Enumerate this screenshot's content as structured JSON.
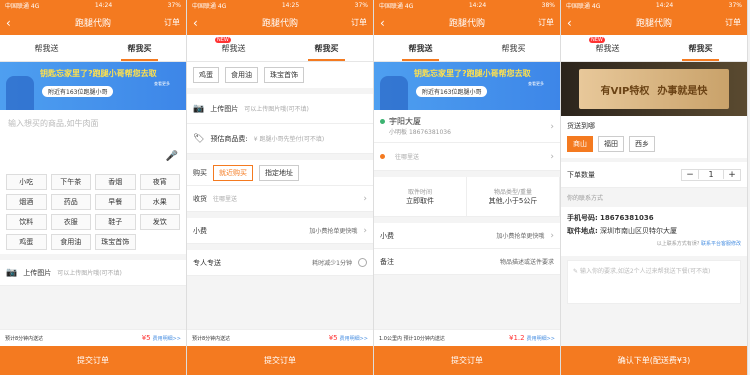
{
  "status": {
    "carrier": "中国联通 4G",
    "t1": "14:24",
    "t2": "14:25",
    "t3": "14:24",
    "t4": "14:24",
    "batt": "37%",
    "batt2": "38%"
  },
  "nav": {
    "title": "跑腿代购",
    "orders": "订单",
    "back": "‹"
  },
  "tabs": {
    "help_send": "帮我送",
    "help_buy": "帮我买",
    "new": "NEW"
  },
  "banner": {
    "title": "钥匙忘家里了?跑腿小哥帮您去取",
    "nearby": "附近有163位跑腿小哥",
    "more": "查看更多"
  },
  "p1": {
    "placeholder": "输入想买的商品,如牛肉面",
    "items": [
      "小吃",
      "下午茶",
      "香烟",
      "夜宵",
      "烟酒",
      "药品",
      "早餐",
      "水果",
      "饮料",
      "衣服",
      "鞋子",
      "发饮",
      "鸡蛋",
      "食用油",
      "珠宝首饰"
    ],
    "upload": "上传图片",
    "upload_hint": "可以上传图片哦(可不填)",
    "est": "预计8分钟内送达",
    "price": "¥5",
    "detail": "费用明细>>",
    "submit": "提交订单"
  },
  "p2": {
    "chips": [
      "鸡蛋",
      "食用油",
      "珠宝首饰"
    ],
    "upload": "上传图片",
    "upload_hint": "可以上传图片哦(可不填)",
    "est_label": "预估商品费:",
    "est_val": "¥ 跑腿小哥先垫付(可不填)",
    "buy": "购买",
    "near": "就近购买",
    "addr": "指定地址",
    "recv": "收货",
    "recv_val": "往哪里送",
    "tip": "小费",
    "tip_val": "加小费抢单更快哦",
    "exclusive": "专人专送",
    "ex_val": "耗时减少1分钟",
    "est": "预计8分钟内送达",
    "price": "¥5",
    "detail": "费用明细>>",
    "submit": "提交订单"
  },
  "p3": {
    "name": "宇阳大厦",
    "phone_label": "小明板",
    "phone": "18676381036",
    "to": "往哪里送",
    "time_l": "取件时间",
    "time_v": "立即取件",
    "type_l": "物品类型/重量",
    "type_v": "其他,小于5公斤",
    "tip": "小费",
    "tip_val": "加小费抢单更快哦",
    "note": "备注",
    "note_val": "物品描述或送件要求",
    "est": "1.0公里内 预计10分钟内送达",
    "price": "¥1.2",
    "detail": "费用明细>>",
    "submit": "提交订单"
  },
  "p4": {
    "vip_a": "有VIP特权",
    "vip_b": "办事就是快",
    "goods": "货送到哪",
    "c1": "商山",
    "c2": "福田",
    "c3": "西乡",
    "qty_l": "下单数量",
    "qty": "1",
    "contact": "你的联系方式",
    "phone_l": "手机号码:",
    "phone": "18676381036",
    "addr_l": "取件地点:",
    "addr": "深圳市南山区贝特尔大厦",
    "note": "以上联系方式有误?",
    "fix": "联系平台客服修改",
    "hint": "输入你的要求,如送2个人过来帮我送下餐(可不填)",
    "submit": "确认下单(配送费¥3)"
  }
}
